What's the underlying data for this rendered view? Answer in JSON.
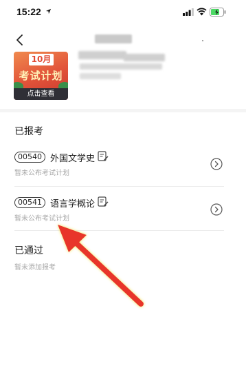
{
  "status_bar": {
    "time": "15:22"
  },
  "banner": {
    "month": "10月",
    "title": "考试计划",
    "button": "点击查看"
  },
  "registered": {
    "title": "已报考",
    "items": [
      {
        "code": "00540",
        "name": "外国文学史",
        "subtitle": "暂未公布考试计划"
      },
      {
        "code": "00541",
        "name": "语言学概论",
        "subtitle": "暂未公布考试计划"
      }
    ]
  },
  "passed": {
    "title": "已通过",
    "subtitle": "暂未添加报考"
  },
  "colors": {
    "accent_red": "#e2543a",
    "annotation_arrow": "#e8352a"
  }
}
